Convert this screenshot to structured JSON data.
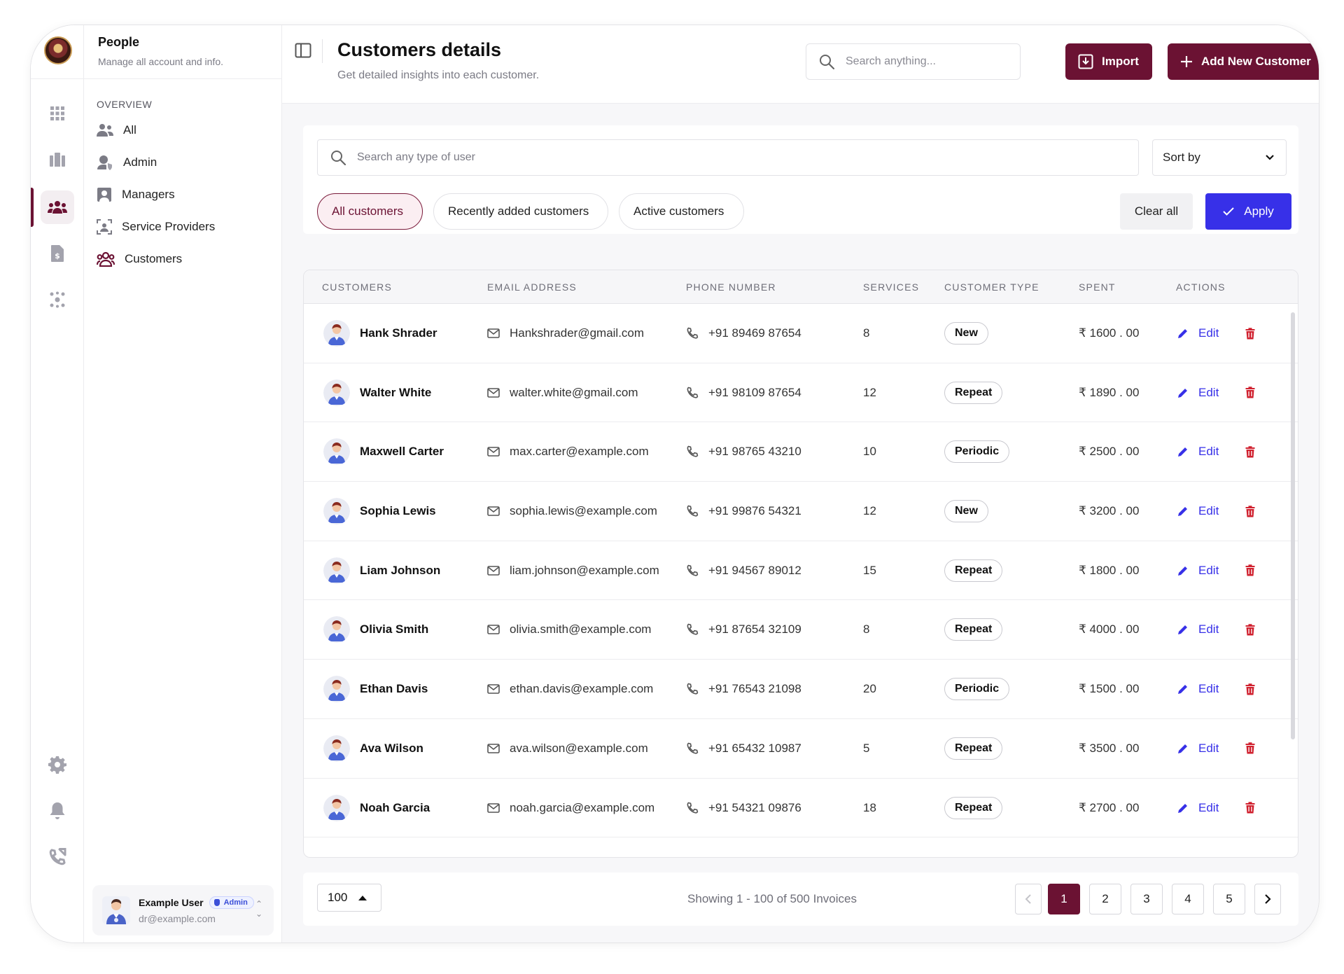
{
  "sidebar": {
    "title": "People",
    "subtitle": "Manage all account and info.",
    "section": "OVERVIEW",
    "items": [
      {
        "label": "All",
        "icon": "users-icon"
      },
      {
        "label": "Admin",
        "icon": "admin-shield-icon"
      },
      {
        "label": "Managers",
        "icon": "manager-icon"
      },
      {
        "label": "Service Providers",
        "icon": "service-provider-icon"
      },
      {
        "label": "Customers",
        "icon": "customers-icon"
      }
    ],
    "user": {
      "name": "Example User",
      "badge": "Admin",
      "email": "dr@example.com"
    }
  },
  "header": {
    "title": "Customers details",
    "subtitle": "Get detailed insights into each customer.",
    "search_placeholder": "Search anything...",
    "import_label": "Import",
    "add_label": "Add New Customer"
  },
  "filters": {
    "search_placeholder": "Search any type of user",
    "sort_label": "Sort by",
    "chips": [
      "All customers",
      "Recently added customers",
      "Active customers"
    ],
    "active_chip": "All customers",
    "clear_label": "Clear all",
    "apply_label": "Apply"
  },
  "table": {
    "columns": [
      "CUSTOMERS",
      "EMAIL ADDRESS",
      "PHONE NUMBER",
      "SERVICES",
      "CUSTOMER TYPE",
      "SPENT",
      "ACTIONS"
    ],
    "edit_label": "Edit",
    "rows": [
      {
        "name": "Hank Shrader",
        "email": "Hankshrader@gmail.com",
        "phone": "+91 89469 87654",
        "services": "8",
        "type": "New",
        "spent": "₹ 1600 . 00"
      },
      {
        "name": "Walter White",
        "email": "walter.white@gmail.com",
        "phone": "+91 98109 87654",
        "services": "12",
        "type": "Repeat",
        "spent": "₹ 1890 . 00"
      },
      {
        "name": "Maxwell Carter",
        "email": "max.carter@example.com",
        "phone": "+91 98765 43210",
        "services": "10",
        "type": "Periodic",
        "spent": "₹ 2500 . 00"
      },
      {
        "name": "Sophia Lewis",
        "email": "sophia.lewis@example.com",
        "phone": "+91 99876 54321",
        "services": "12",
        "type": "New",
        "spent": "₹ 3200 . 00"
      },
      {
        "name": "Liam Johnson",
        "email": "liam.johnson@example.com",
        "phone": "+91 94567 89012",
        "services": "15",
        "type": "Repeat",
        "spent": "₹ 1800 . 00"
      },
      {
        "name": "Olivia Smith",
        "email": "olivia.smith@example.com",
        "phone": "+91 87654 32109",
        "services": "8",
        "type": "Repeat",
        "spent": "₹ 4000 . 00"
      },
      {
        "name": "Ethan Davis",
        "email": "ethan.davis@example.com",
        "phone": "+91 76543 21098",
        "services": "20",
        "type": "Periodic",
        "spent": "₹ 1500 . 00"
      },
      {
        "name": "Ava Wilson",
        "email": "ava.wilson@example.com",
        "phone": "+91 65432 10987",
        "services": "5",
        "type": "Repeat",
        "spent": "₹ 3500 . 00"
      },
      {
        "name": "Noah Garcia",
        "email": "noah.garcia@example.com",
        "phone": "+91 54321 09876",
        "services": "18",
        "type": "Repeat",
        "spent": "₹ 2700 . 00"
      }
    ]
  },
  "pagination": {
    "per_page": "100",
    "showing": "Showing 1 - 100 of 500 Invoices",
    "pages": [
      "1",
      "2",
      "3",
      "4",
      "5"
    ],
    "current_page": "1"
  },
  "colors": {
    "brand": "#6b1233",
    "accent": "#3730e8",
    "delete": "#d0202e"
  }
}
